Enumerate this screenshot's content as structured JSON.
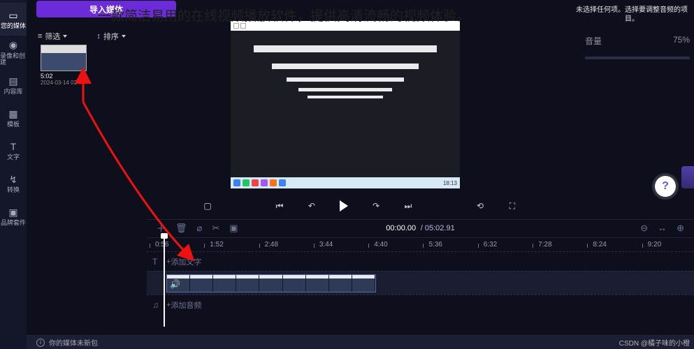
{
  "rail": {
    "items": [
      {
        "label": "您的媒体",
        "icon_name": "folder-icon"
      },
      {
        "label": "录像和创建",
        "icon_name": "camera-icon"
      },
      {
        "label": "内容库",
        "icon_name": "library-icon"
      },
      {
        "label": "模板",
        "icon_name": "templates-icon"
      },
      {
        "label": "文字",
        "icon_name": "text-tool-icon"
      },
      {
        "label": "转换",
        "icon_name": "transition-icon"
      },
      {
        "label": "品牌套件",
        "icon_name": "brand-kit-icon"
      }
    ]
  },
  "topbar": {
    "import_label": "导入媒体"
  },
  "filters": {
    "filter_label": "筛选",
    "sort_label": "排序"
  },
  "media": {
    "items": [
      {
        "duration": "5:02",
        "date": "2024-03-14 03"
      }
    ]
  },
  "banner_text": "一款简洁易用的在线视频播放软件，提供高清流畅的视频体验。",
  "side_hint": "未选择任何项。选择要调整音频的项目。",
  "preview_taskbar_time": "18:13",
  "help_label": "?",
  "player": {
    "step_back_icon": "rotate-ccw-icon",
    "play_icon": "play-icon",
    "step_fwd_icon": "rotate-cw-icon",
    "prev_icon": "skip-back-icon",
    "next_icon": "skip-forward-icon",
    "screenshot_icon": "screenshot-icon",
    "undo_icon": "undo-icon",
    "fullscreen_icon": "fullscreen-icon"
  },
  "right_panel": {
    "volume_label": "音量",
    "volume_value": "75%"
  },
  "timeline": {
    "cur": "00:00.00",
    "dur": "05:02.91",
    "ticks": [
      "0:56",
      "1:52",
      "2:48",
      "3:44",
      "4:40",
      "5:36",
      "6:32",
      "7:28",
      "8:24",
      "9:20"
    ],
    "text_track_label": "添加文字",
    "audio_track_label": "添加音频",
    "tool_icons": {
      "delete": "delete-icon",
      "split": "split-icon",
      "scissors": "scissors-icon",
      "playrate": "speed-icon",
      "zoom_out": "zoom-out-icon",
      "zoom_fit": "zoom-fit-icon",
      "zoom_in": "zoom-in-icon"
    }
  },
  "bottom_status": "你的媒体未新包",
  "watermark": "CSDN @橘子味的小橙"
}
